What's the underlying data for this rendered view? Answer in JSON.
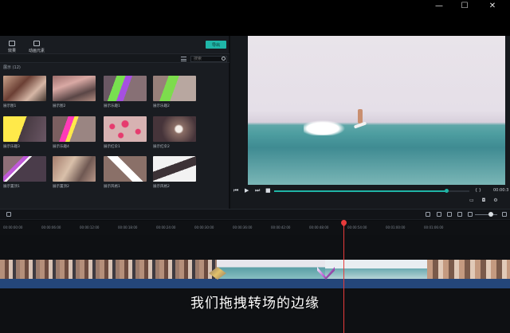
{
  "window": {
    "controls": [
      "—",
      "☐",
      "✕"
    ]
  },
  "media": {
    "tabs": [
      {
        "label": "效果",
        "icon": "effects-icon"
      },
      {
        "label": "动画元素",
        "icon": "elements-icon"
      }
    ],
    "export_label": "导出",
    "search_placeholder": "搜索",
    "category_label": "展示 (12)",
    "items": [
      {
        "label": "展示图1",
        "style": "t-photo"
      },
      {
        "label": "展示图2",
        "style": "t-photo2"
      },
      {
        "label": "展示乐趣1",
        "style": "t-lime"
      },
      {
        "label": "展示乐趣2",
        "style": "t-lime2"
      },
      {
        "label": "展示乐趣3",
        "style": "t-yellow"
      },
      {
        "label": "展示乐趣4",
        "style": "t-magenta"
      },
      {
        "label": "展示红伞1",
        "style": "t-dots"
      },
      {
        "label": "展示红伞2",
        "style": "t-burst"
      },
      {
        "label": "展示置顶1",
        "style": "t-chevron"
      },
      {
        "label": "展示置顶2",
        "style": "t-photo3"
      },
      {
        "label": "展示风格1",
        "style": "t-x"
      },
      {
        "label": "展示风格2",
        "style": "t-x2"
      }
    ]
  },
  "preview": {
    "buttons": [
      "⏮",
      "▶",
      "⏭",
      "■"
    ],
    "progress": 0.88,
    "brackets": "{  }",
    "timecode": "00:00:3",
    "tools": "▭ ◘ ⚙"
  },
  "timeline": {
    "ruler": [
      "00:00:00:00",
      "00:00:06:00",
      "00:00:12:00",
      "00:00:18:00",
      "00:00:24:00",
      "00:00:30:00",
      "00:00:36:00",
      "00:00:42:00",
      "00:00:48:00",
      "00:00:54:00",
      "00:01:00:00",
      "00:01:06:00"
    ],
    "subtitle": "我们拖拽转场的边缘"
  },
  "colors": {
    "accent": "#1fb6a8",
    "playhead": "#e83b3b",
    "clip_bar": "#24467a"
  }
}
